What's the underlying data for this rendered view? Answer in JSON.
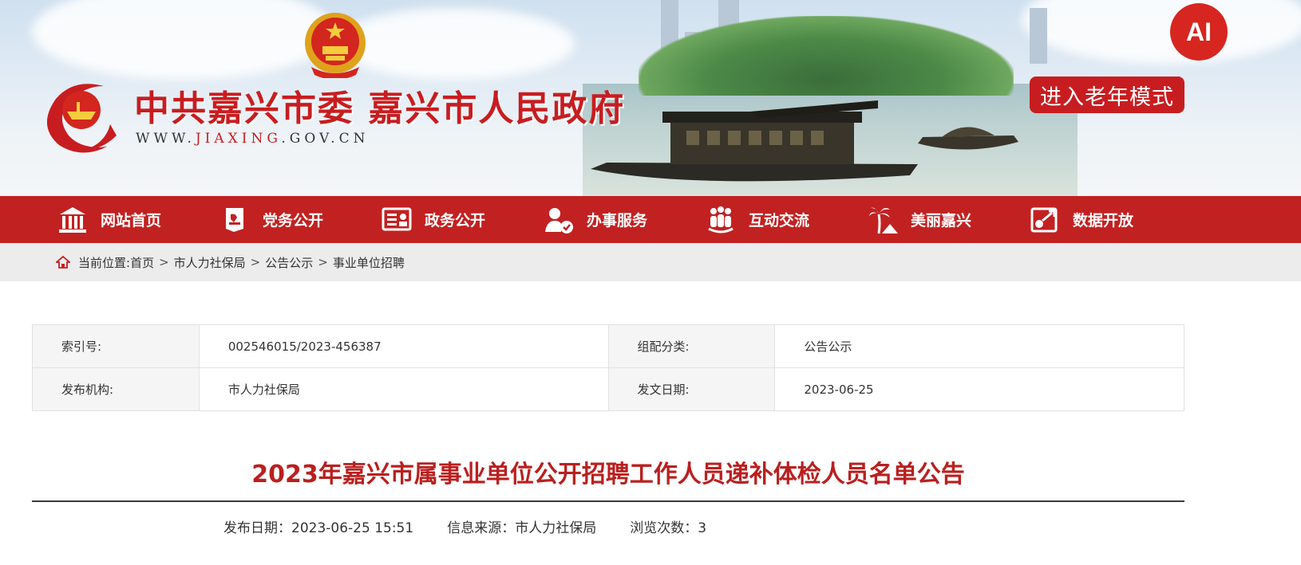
{
  "header": {
    "site_title": "中共嘉兴市委 嘉兴市人民政府",
    "url_prefix": "WWW.",
    "url_highlight": "JIAXING",
    "url_suffix": ".GOV.CN",
    "ai_badge": "AI",
    "elder_mode": "进入老年模式"
  },
  "nav": [
    {
      "label": "网站首页",
      "icon": "home-icon"
    },
    {
      "label": "党务公开",
      "icon": "party-icon"
    },
    {
      "label": "政务公开",
      "icon": "gov-board-icon"
    },
    {
      "label": "办事服务",
      "icon": "service-icon"
    },
    {
      "label": "互动交流",
      "icon": "people-icon"
    },
    {
      "label": "美丽嘉兴",
      "icon": "palm-tree-icon"
    },
    {
      "label": "数据开放",
      "icon": "data-icon"
    }
  ],
  "breadcrumb": {
    "prefix": "当前位置:",
    "items": [
      "首页",
      "市人力社保局",
      "公告公示",
      "事业单位招聘"
    ],
    "separator": ">"
  },
  "info": {
    "index_label": "索引号:",
    "index_value": "002546015/2023-456387",
    "category_label": "组配分类:",
    "category_value": "公告公示",
    "issuer_label": "发布机构:",
    "issuer_value": "市人力社保局",
    "date_label": "发文日期:",
    "date_value": "2023-06-25"
  },
  "article": {
    "title": "2023年嘉兴市属事业单位公开招聘工作人员递补体检人员名单公告",
    "publish": "发布日期：2023-06-25 15:51",
    "source": "信息来源：市人力社保局",
    "views": "浏览次数：3"
  },
  "colors": {
    "brand_red": "#c22121",
    "title_red": "#b9201f"
  }
}
